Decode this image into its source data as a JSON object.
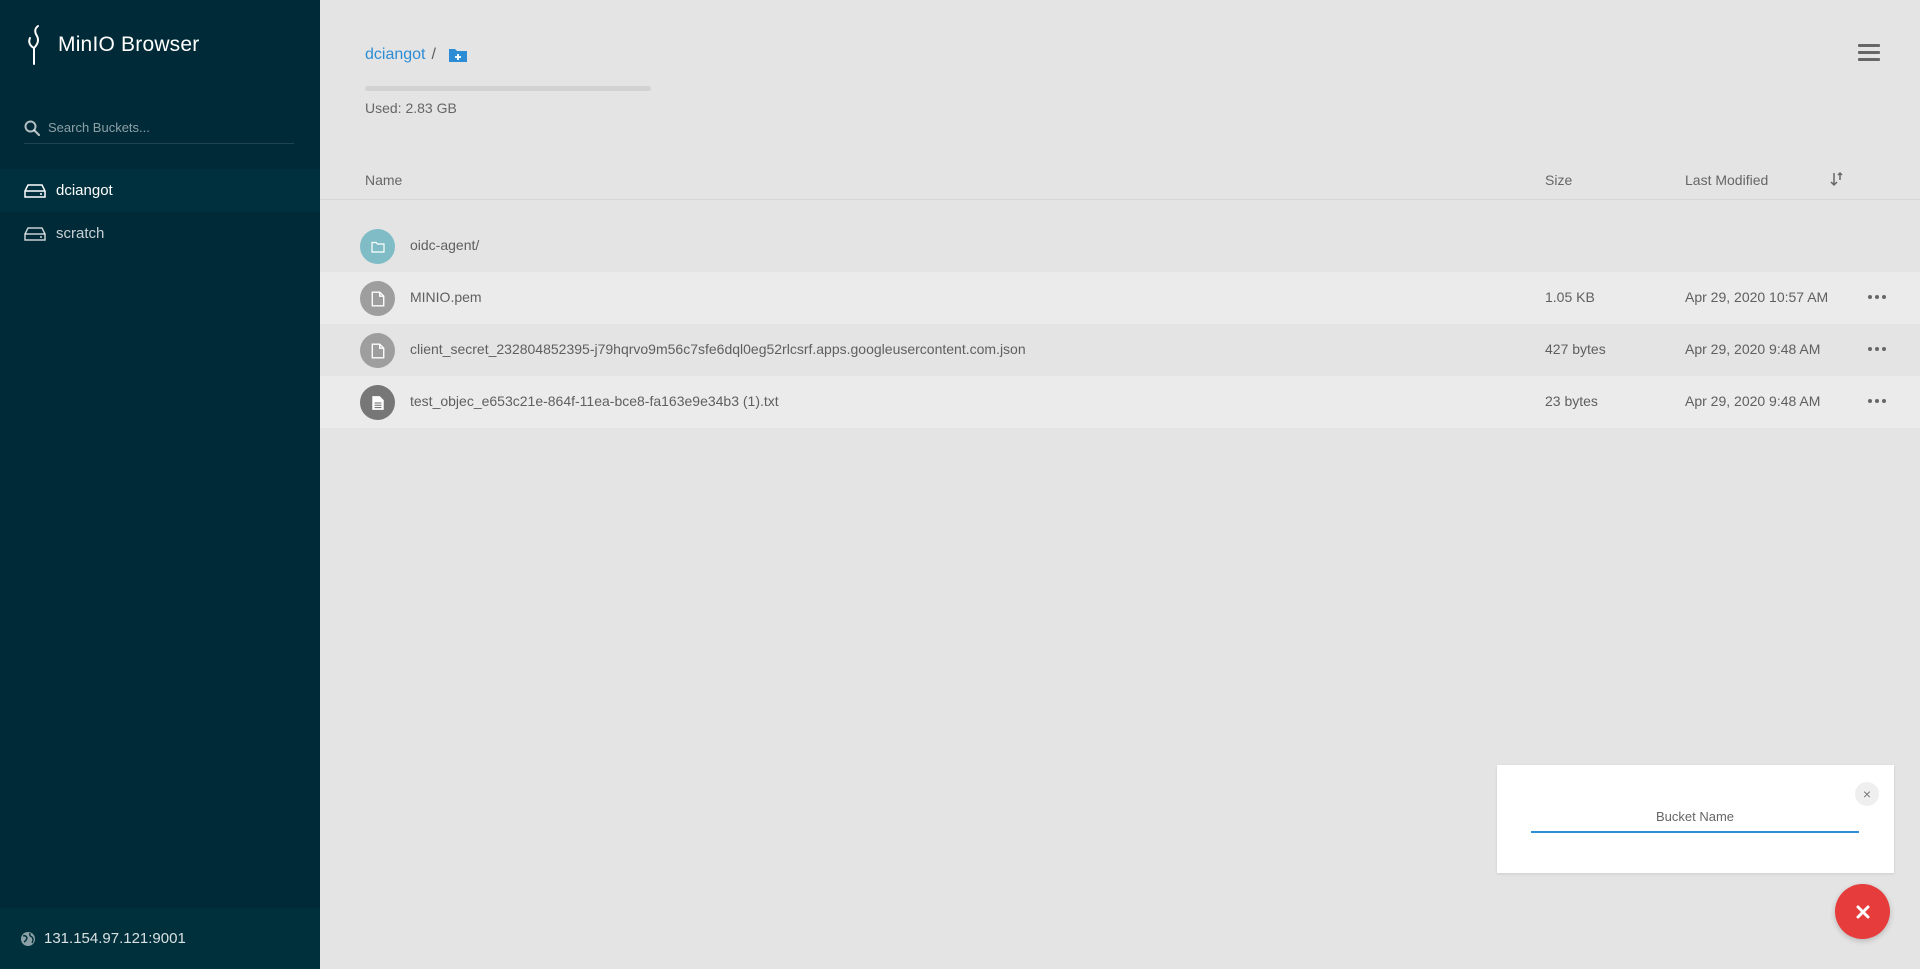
{
  "app": {
    "title": "MinIO Browser"
  },
  "sidebar": {
    "search_placeholder": "Search Buckets...",
    "buckets": [
      {
        "label": "dciangot",
        "active": true
      },
      {
        "label": "scratch",
        "active": false
      }
    ],
    "host": "131.154.97.121:9001"
  },
  "main": {
    "breadcrumb": {
      "bucket": "dciangot",
      "separator": "/"
    },
    "usage": {
      "label": "Used: 2.83 GB"
    },
    "columns": {
      "name": "Name",
      "size": "Size",
      "modified": "Last Modified"
    },
    "rows": [
      {
        "name": "oidc-agent/",
        "size": "",
        "modified": "",
        "type": "folder"
      },
      {
        "name": "MINIO.pem",
        "size": "1.05 KB",
        "modified": "Apr 29, 2020 10:57 AM",
        "type": "file"
      },
      {
        "name": "client_secret_232804852395-j79hqrvo9m56c7sfe6dql0eg52rlcsrf.apps.googleusercontent.com.json",
        "size": "427 bytes",
        "modified": "Apr 29, 2020 9:48 AM",
        "type": "file"
      },
      {
        "name": "test_objec_e653c21e-864f-11ea-bce8-fa163e9e34b3 (1).txt",
        "size": "23 bytes",
        "modified": "Apr 29, 2020 9:48 AM",
        "type": "text"
      }
    ]
  },
  "dialog": {
    "placeholder": "Bucket Name",
    "close_label": "×"
  },
  "colors": {
    "sidebar": "#002a37",
    "accent": "#2d8dd4",
    "fab": "#e63c3c",
    "folder_icon": "#7fbcc6",
    "file_icon": "#9e9e9e",
    "text_icon": "#777777"
  }
}
